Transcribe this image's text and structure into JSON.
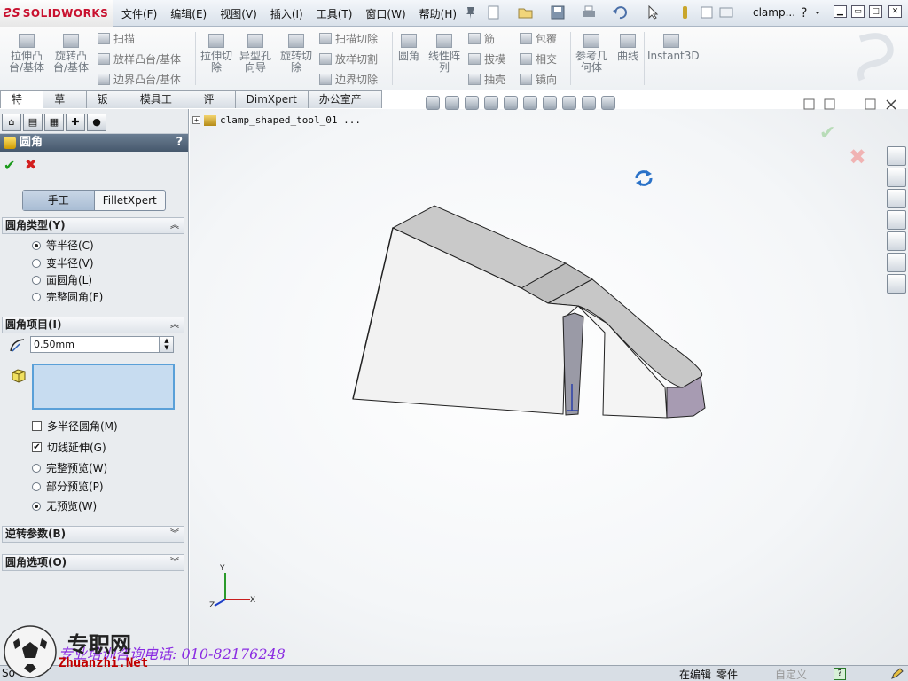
{
  "app": {
    "brand": "SOLIDWORKS",
    "doc_title": "clamp..."
  },
  "menu": [
    "文件(F)",
    "编辑(E)",
    "视图(V)",
    "插入(I)",
    "工具(T)",
    "窗口(W)",
    "帮助(H)"
  ],
  "ribbon": {
    "big": [
      {
        "label": "拉伸凸\n台/基体"
      },
      {
        "label": "旋转凸\n台/基体"
      },
      {
        "label": "拉伸切\n除"
      },
      {
        "label": "异型孔\n向导"
      },
      {
        "label": "旋转切\n除"
      },
      {
        "label": "圆角"
      },
      {
        "label": "线性阵\n列"
      },
      {
        "label": "参考几\n何体"
      },
      {
        "label": "曲线"
      },
      {
        "label": "Instant3D"
      }
    ],
    "small": [
      "扫描",
      "放样凸台/基体",
      "边界凸台/基体",
      "扫描切除",
      "放样切割",
      "边界切除",
      "筋",
      "拔模",
      "抽壳",
      "包覆",
      "相交",
      "镜向"
    ]
  },
  "tabs": [
    "特征",
    "草图",
    "钣金",
    "模具工具",
    "评估",
    "DimXpert",
    "办公室产品"
  ],
  "panel": {
    "title": "圆角",
    "help": "?",
    "mode_manual": "手工",
    "mode_filletxpert": "FilletXpert",
    "type_section": "圆角类型(Y)",
    "types": [
      "等半径(C)",
      "变半径(V)",
      "面圆角(L)",
      "完整圆角(F)"
    ],
    "items_section": "圆角项目(I)",
    "radius_value": "0.50mm",
    "multi_radius": "多半径圆角(M)",
    "tangent_propagation": "切线延伸(G)",
    "previews": [
      "完整预览(W)",
      "部分预览(P)",
      "无预览(W)"
    ],
    "reverse_section": "逆转参数(B)",
    "options_section": "圆角选项(O)"
  },
  "viewport": {
    "tree_root": "clamp_shaped_tool_01  ...",
    "axis_x": "X",
    "axis_y": "Y",
    "axis_z": "Z"
  },
  "status": {
    "left": "So",
    "editing": "在编辑",
    "part": "零件",
    "custom": "自定义",
    "help": "?"
  },
  "watermark": {
    "brand": "专职网",
    "site": "Zhuanzhi.Net",
    "phone": "专业培训咨询电话: 010-82176248"
  }
}
